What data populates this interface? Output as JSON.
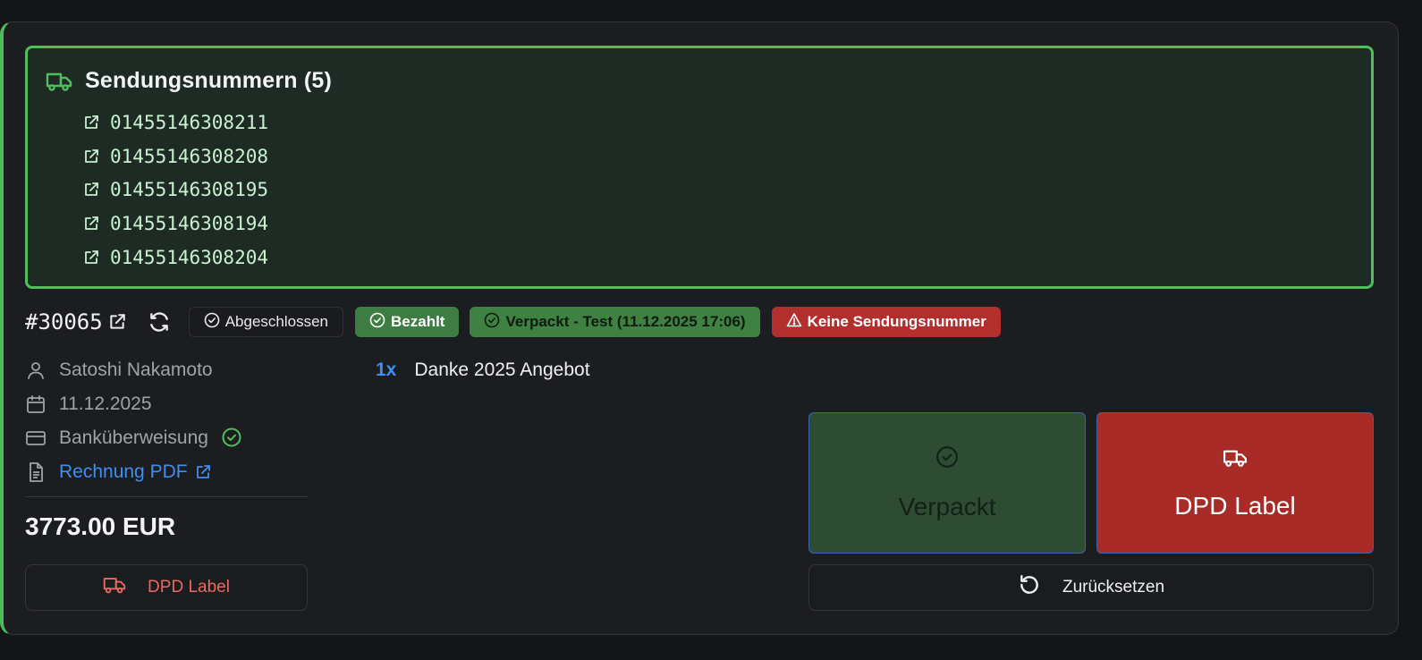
{
  "shipments": {
    "title": "Sendungsnummern (5)",
    "icon": "truck-icon",
    "tracking_numbers": [
      "01455146308211",
      "01455146308208",
      "01455146308195",
      "01455146308194",
      "01455146308204"
    ]
  },
  "order": {
    "number": "#30065",
    "badges": {
      "status": "Abgeschlossen",
      "payment": "Bezahlt",
      "packed": "Verpackt - Test (11.12.2025 17:06)",
      "warning": "Keine Sendungsnummer"
    },
    "customer": "Satoshi Nakamoto",
    "date": "11.12.2025",
    "payment_method": "Banküberweisung",
    "invoice_link": "Rechnung PDF",
    "total": "3773.00 EUR",
    "dpd_button": "DPD Label"
  },
  "items": [
    {
      "qty": "1x",
      "name": "Danke 2025 Angebot"
    }
  ],
  "actions": {
    "packed": "Verpackt",
    "dpd_label": "DPD Label",
    "reset": "Zurücksetzen"
  },
  "colors": {
    "accent_green": "#4fbf5c",
    "badge_red": "#b22f2d",
    "link_blue": "#3f8ef0"
  }
}
